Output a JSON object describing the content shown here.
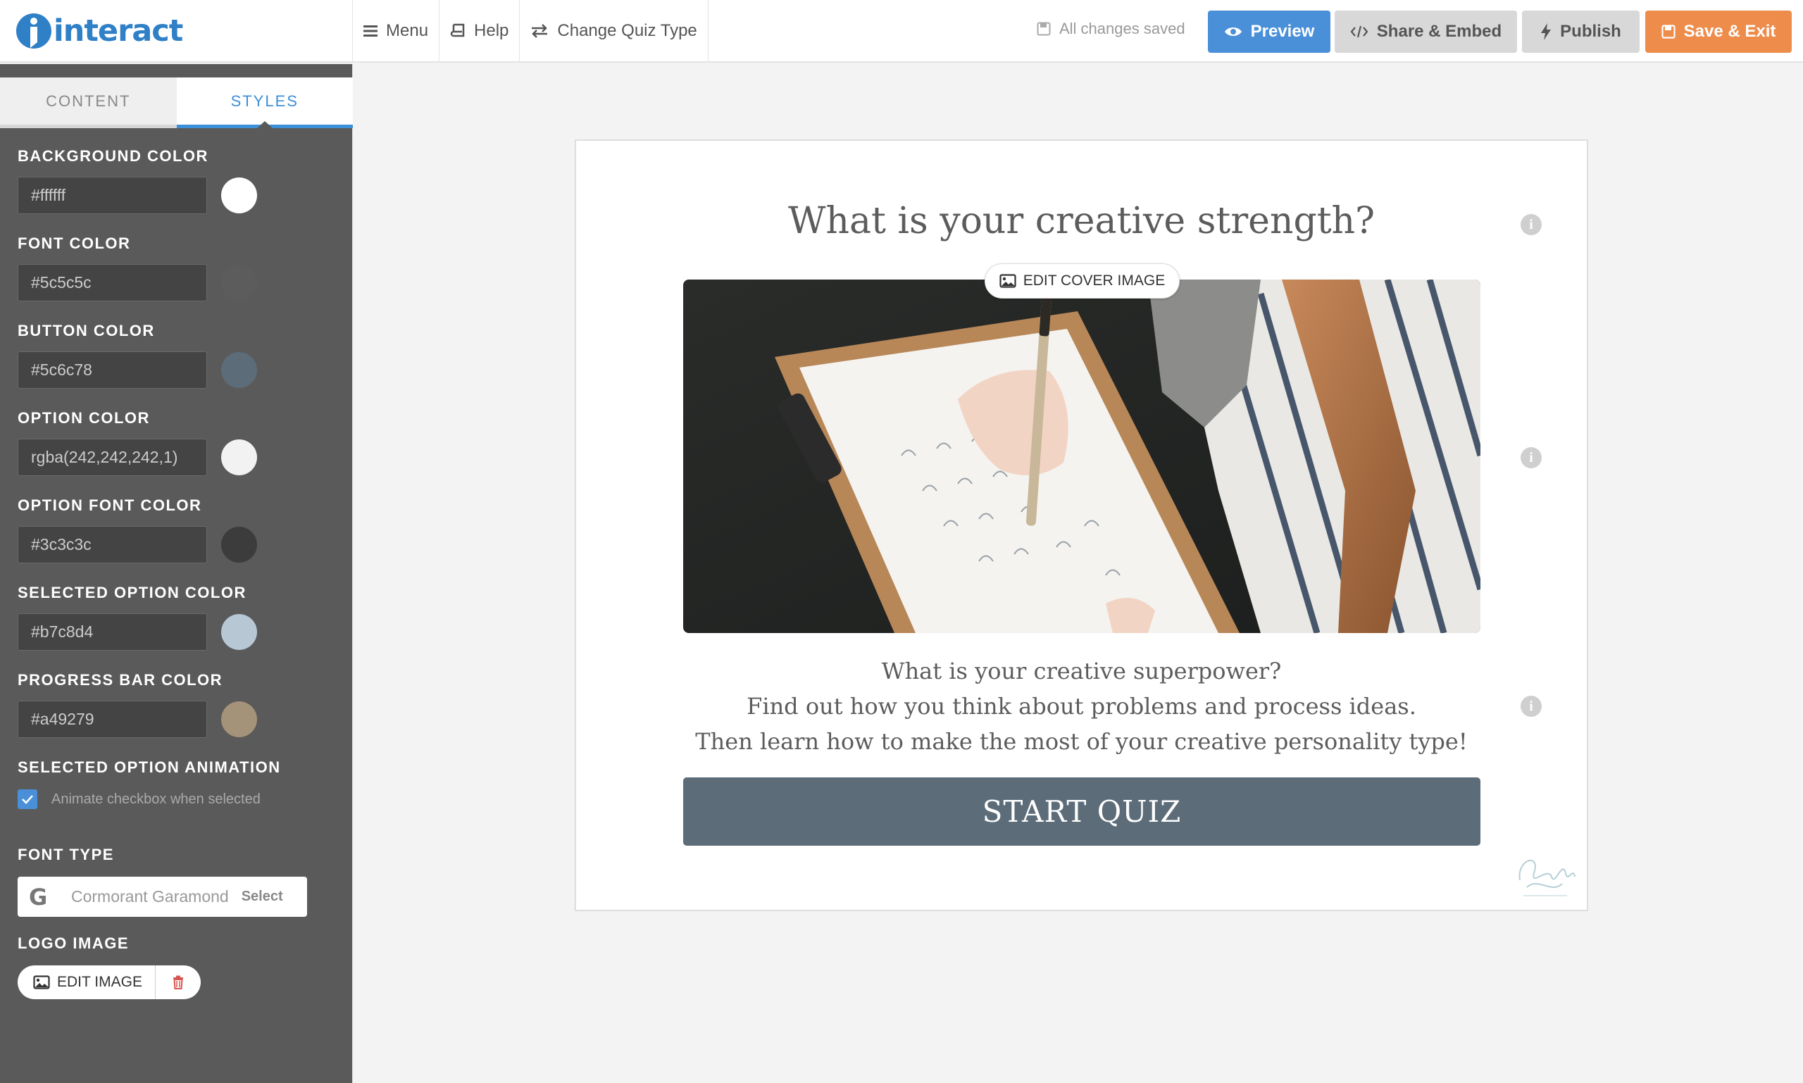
{
  "app": {
    "logo_text": "interact",
    "brand_color": "#2f80c7"
  },
  "toolbar": {
    "menu_label": "Menu",
    "help_label": "Help",
    "change_type_label": "Change Quiz Type",
    "save_status": "All changes saved",
    "preview_label": "Preview",
    "share_label": "Share & Embed",
    "publish_label": "Publish",
    "save_exit_label": "Save & Exit",
    "preview_color": "#4a90d9",
    "save_exit_color": "#ee8d4b"
  },
  "sidebar": {
    "tabs": [
      {
        "label": "CONTENT",
        "active": false
      },
      {
        "label": "STYLES",
        "active": true
      }
    ],
    "fields": [
      {
        "label": "BACKGROUND COLOR",
        "value": "#ffffff",
        "swatch": "#ffffff"
      },
      {
        "label": "FONT COLOR",
        "value": "#5c5c5c",
        "swatch": "#5c5c5c"
      },
      {
        "label": "BUTTON COLOR",
        "value": "#5c6c78",
        "swatch": "#5c6c78"
      },
      {
        "label": "OPTION COLOR",
        "value": "rgba(242,242,242,1)",
        "swatch": "#f2f2f2"
      },
      {
        "label": "OPTION FONT COLOR",
        "value": "#3c3c3c",
        "swatch": "#3c3c3c"
      },
      {
        "label": "SELECTED OPTION COLOR",
        "value": "#b7c8d4",
        "swatch": "#b7c8d4"
      },
      {
        "label": "PROGRESS BAR COLOR",
        "value": "#a49279",
        "swatch": "#a49279"
      }
    ],
    "animation": {
      "label": "SELECTED OPTION ANIMATION",
      "checkbox_label": "Animate checkbox when selected",
      "checked": true
    },
    "font_type": {
      "label": "FONT TYPE",
      "provider_icon": "google-g-icon",
      "value": "Cormorant Garamond",
      "select_label": "Select"
    },
    "logo_image": {
      "label": "LOGO IMAGE",
      "edit_label": "EDIT IMAGE",
      "delete_icon": "trash-icon"
    }
  },
  "quiz": {
    "title": "What is your creative strength?",
    "edit_cover_label": "EDIT COVER IMAGE",
    "description": [
      "What is your creative superpower?",
      "Find out how you think about problems and process ideas.",
      "Then learn how to make the most of your creative personality type!"
    ],
    "start_label": "START QUIZ"
  }
}
